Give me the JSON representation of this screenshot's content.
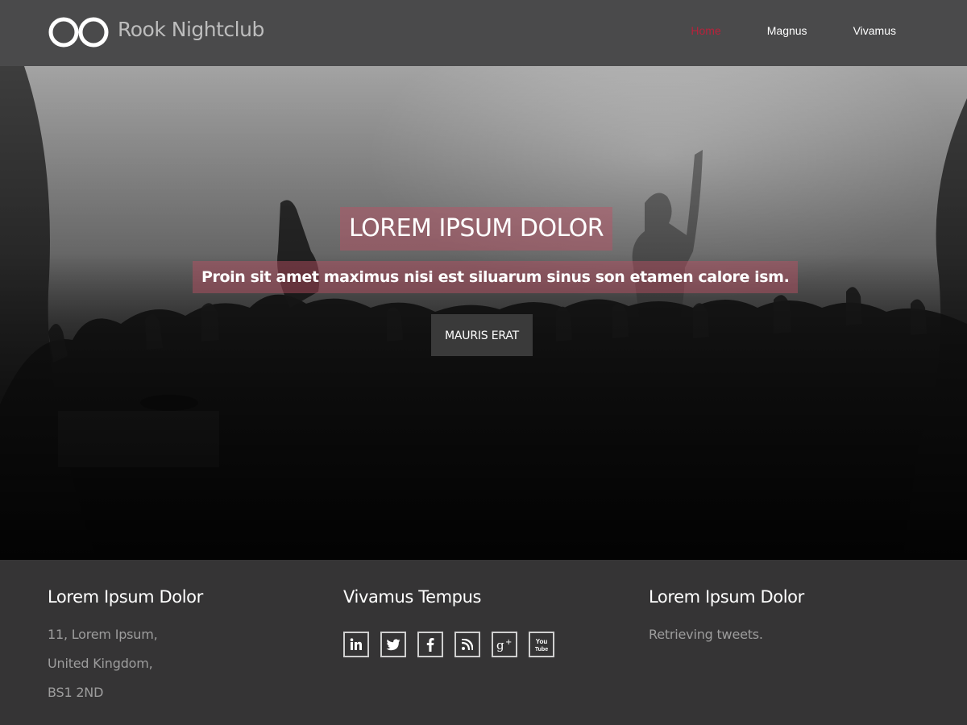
{
  "header": {
    "brand": "Rook Nightclub",
    "nav": [
      {
        "label": "Home",
        "active": true
      },
      {
        "label": "Magnus",
        "active": false
      },
      {
        "label": "Vivamus",
        "active": false
      }
    ]
  },
  "hero": {
    "title": "LOREM IPSUM DOLOR",
    "subtitle": "Proin sit amet maximus nisi est siluarum sinus son etamen calore ism.",
    "button_label": "MAURIS ERAT"
  },
  "footer": {
    "col1": {
      "heading": "Lorem Ipsum Dolor",
      "address": [
        "11, Lorem Ipsum,",
        "United Kingdom,",
        "BS1 2ND"
      ]
    },
    "col2": {
      "heading": "Vivamus Tempus",
      "social": [
        "linkedin-icon",
        "twitter-icon",
        "facebook-icon",
        "rss-icon",
        "google-plus-icon",
        "youtube-icon"
      ],
      "youtube_text": [
        "You",
        "Tube"
      ]
    },
    "col3": {
      "heading": "Lorem Ipsum Dolor",
      "tweets_status": "Retrieving tweets."
    }
  },
  "colors": {
    "accent": "#b8223b",
    "header_bg": "#4a4a4b",
    "footer_bg": "#353435",
    "hero_highlight": "#be5064"
  }
}
